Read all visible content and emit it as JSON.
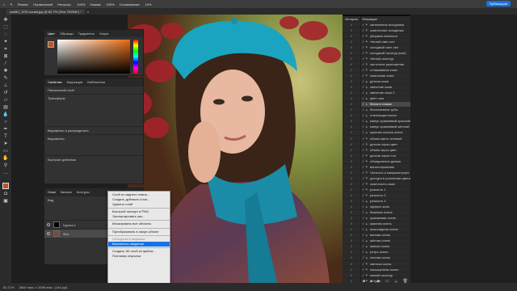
{
  "menubar": {
    "items": [
      "Режим:",
      "Нормальный",
      "Непрозр.:",
      "100%",
      "Нажим:",
      "100%",
      "Сглаживание:",
      "10%"
    ],
    "publish": "Публикация"
  },
  "tab": {
    "title": "ксеМС_5761 копия.jpg @ 82,7% (Фон, RGB/8*) *"
  },
  "color_panel": {
    "tabs": [
      "Цвет",
      "Образцы",
      "Градиенты",
      "Узоры"
    ],
    "fg_color": "#c0521f",
    "bg_color": "#ffffff"
  },
  "properties_panel": {
    "tabs": [
      "Свойства",
      "Коррекция",
      "Библиотеки"
    ],
    "layer_kind": "Пиксельный слой",
    "transform": "Трансформ.",
    "align": "Выровнять и распределить",
    "align_sub": "Выровнять:",
    "quick_actions": "Быстрые действия"
  },
  "layers_panel": {
    "tabs": [
      "Слои",
      "Каналы",
      "Контуры"
    ],
    "search_placeholder": "Вид",
    "layers": [
      {
        "name": "Группа 1",
        "kind": "group"
      },
      {
        "name": "Фон",
        "kind": "image"
      }
    ]
  },
  "context_menu": {
    "items": [
      {
        "label": "Слой из заднего плана...",
        "state": "normal"
      },
      {
        "label": "Создать дубликат слоя...",
        "state": "normal"
      },
      {
        "label": "Удалить слой",
        "state": "normal"
      },
      {
        "sep": true
      },
      {
        "label": "Быстрый экспорт в PNG",
        "state": "normal"
      },
      {
        "label": "Экспортировать как...",
        "state": "normal"
      },
      {
        "sep": true
      },
      {
        "label": "Маскировать все объекты",
        "state": "normal"
      },
      {
        "sep": true
      },
      {
        "label": "Преобразовать в смарт-объект",
        "state": "normal"
      },
      {
        "sep": true
      },
      {
        "label": "Объединить видимые",
        "state": "dis"
      },
      {
        "label": "Выполнить сведение",
        "state": "hl"
      },
      {
        "sep": true
      },
      {
        "label": "Создать 3D-слой из файла...",
        "state": "normal"
      },
      {
        "label": "Почтовая открытка",
        "state": "normal"
      }
    ]
  },
  "history_panel": {
    "title": "История"
  },
  "actions_panel": {
    "title": "Операции",
    "items": [
      "затемнение исходника",
      "осветление исходника",
      "убираем певности",
      "тёплый свет-сеп",
      "холодный свет-сеп",
      "холодный оконтур (шаг)",
      "тёплый оконтур",
      "частотное разложение",
      "сглаживание кожи",
      "смягчение кожи",
      "детали кожи",
      "свечение кожи",
      "свечение кожи 2",
      "цвет глаз",
      "блеск в глазах",
      "бесполезные зубы",
      "стилизация волос",
      "минус оранжевый красный",
      "минус оранжевый жёлтый",
      "красная сочная осень",
      "объем свето-теневой",
      "детали через цвет",
      "объем через цвет",
      "детали через тон",
      "объединение дымка",
      "виньетирование",
      "Четкость и микроконтраст",
      "дохтура в уточнении цвета",
      "смягчность кожи",
      "резкость 1",
      "резкость 2",
      "резкость 3",
      "эффект кино",
      "бежевая осень",
      "оранжевая осень",
      "красная осень",
      "шоколадная осень",
      "винная осень",
      "жёлтая осень",
      "мягкая осень",
      "ретро осень",
      "лесная осень",
      "светлая осень",
      "насыщенная осень",
      "мягкий оконтур",
      "ретушь"
    ],
    "selected_index": 14
  },
  "status": {
    "zoom": "82,71%",
    "size": "3840 пикс. x 2696 пикс. (144 ppi)"
  }
}
